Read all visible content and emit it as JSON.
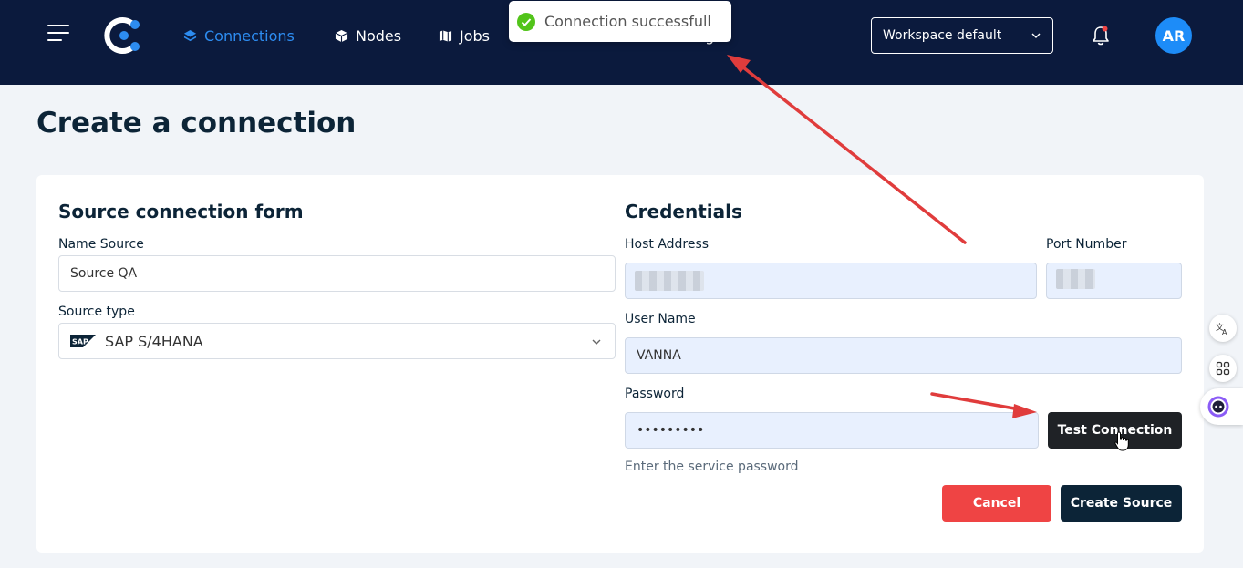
{
  "nav": {
    "items": [
      {
        "label": "Connections",
        "icon": "layers-icon",
        "active": true
      },
      {
        "label": "Nodes",
        "icon": "cube-icon",
        "active": false
      },
      {
        "label": "Jobs",
        "icon": "map-icon",
        "active": false
      },
      {
        "label": "ngs",
        "icon": "settings-icon",
        "active": false
      }
    ],
    "workspace": "Workspace default",
    "avatar_initials": "AR"
  },
  "toast": {
    "message": "Connection successfull",
    "icon": "check-circle-icon"
  },
  "page": {
    "title": "Create a connection"
  },
  "source_form": {
    "title": "Source connection form",
    "name_label": "Name Source",
    "name_value": "Source QA",
    "type_label": "Source type",
    "type_value": "SAP S/4HANA"
  },
  "credentials": {
    "title": "Credentials",
    "host_label": "Host Address",
    "port_label": "Port Number",
    "user_label": "User Name",
    "user_value": "VANNA",
    "password_label": "Password",
    "password_value": "•••••••••",
    "password_help": "Enter the service password",
    "test_button": "Test Connection"
  },
  "actions": {
    "cancel": "Cancel",
    "create": "Create Source"
  },
  "side_tools": [
    "translate-icon",
    "apps-grid-icon",
    "assistant-icon"
  ],
  "colors": {
    "navbar": "#0b1a3d",
    "accent": "#2d8cf0",
    "danger": "#ef4444",
    "navy": "#0c2437",
    "success": "#52c41a",
    "annotation": "#e03c3c"
  }
}
